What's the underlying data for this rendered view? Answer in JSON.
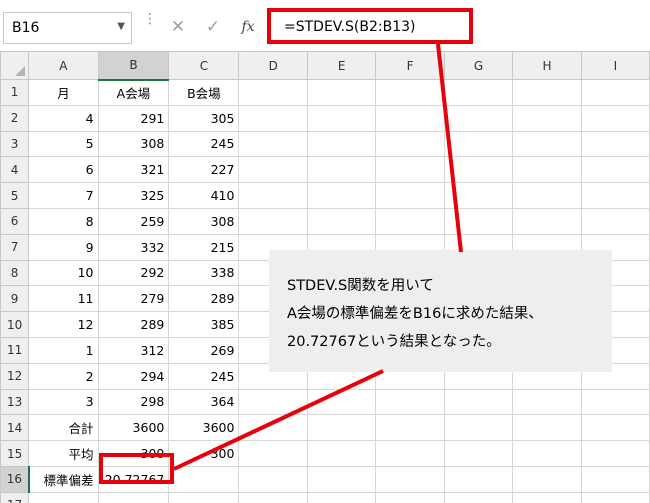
{
  "name_box": {
    "value": "B16"
  },
  "formula_bar": {
    "cancel_icon": "close-icon",
    "enter_icon": "check-icon",
    "fx_label": "fx",
    "formula": "=STDEV.S(B2:B13)"
  },
  "columns": [
    "A",
    "B",
    "C",
    "D",
    "E",
    "F",
    "G",
    "H",
    "I"
  ],
  "rows": [
    {
      "num": "1",
      "a": "月",
      "b": "A会場",
      "c": "B会場"
    },
    {
      "num": "2",
      "a": "4",
      "b": "291",
      "c": "305"
    },
    {
      "num": "3",
      "a": "5",
      "b": "308",
      "c": "245"
    },
    {
      "num": "4",
      "a": "6",
      "b": "321",
      "c": "227"
    },
    {
      "num": "5",
      "a": "7",
      "b": "325",
      "c": "410"
    },
    {
      "num": "6",
      "a": "8",
      "b": "259",
      "c": "308"
    },
    {
      "num": "7",
      "a": "9",
      "b": "332",
      "c": "215"
    },
    {
      "num": "8",
      "a": "10",
      "b": "292",
      "c": "338"
    },
    {
      "num": "9",
      "a": "11",
      "b": "279",
      "c": "289"
    },
    {
      "num": "10",
      "a": "12",
      "b": "289",
      "c": "385"
    },
    {
      "num": "11",
      "a": "1",
      "b": "312",
      "c": "269"
    },
    {
      "num": "12",
      "a": "2",
      "b": "294",
      "c": "245"
    },
    {
      "num": "13",
      "a": "3",
      "b": "298",
      "c": "364"
    },
    {
      "num": "14",
      "a": "合計",
      "b": "3600",
      "c": "3600"
    },
    {
      "num": "15",
      "a": "平均",
      "b": "300",
      "c": "300"
    },
    {
      "num": "16",
      "a": "標準偏差",
      "b": "20.72767",
      "c": ""
    },
    {
      "num": "17",
      "a": "",
      "b": "",
      "c": ""
    }
  ],
  "annotation": {
    "line1": "STDEV.S関数を用いて",
    "line2": "A会場の標準偏差をB16に求めた結果、",
    "line3": "20.72767という結果となった。"
  },
  "colors": {
    "highlight": "#e8000b",
    "selection": "#217346",
    "callout_bg": "#eeeeee"
  }
}
